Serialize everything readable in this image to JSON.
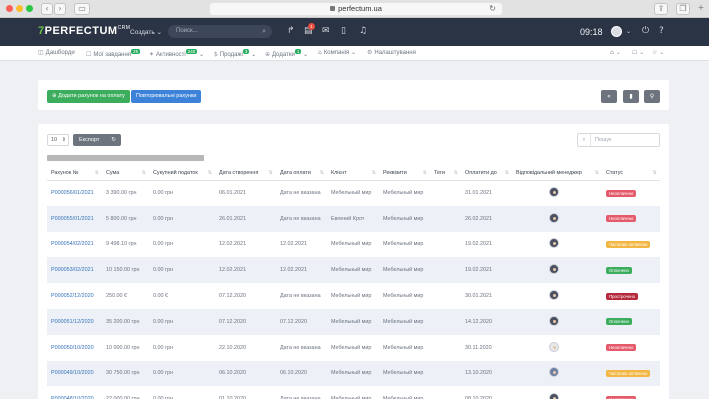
{
  "browser": {
    "url": "perfectum.ua",
    "back_glyph": "‹",
    "forward_glyph": "›",
    "reload_glyph": "↻"
  },
  "topbar": {
    "logo": "PERFECTUM",
    "logo_digit": "7",
    "logo_sup": "CRM",
    "create_label": "Создать ⌄",
    "search_placeholder": "Поиск...",
    "notif_count": "1",
    "time": "09:18",
    "avatar_caret": "⌄",
    "power_glyph": "⏻",
    "help_glyph": "?"
  },
  "nav": {
    "items": [
      {
        "icon": "dashboard-icon",
        "glyph": "◫",
        "label": "Дашборди"
      },
      {
        "icon": "tasks-icon",
        "glyph": "☐",
        "label": "Мої завдання",
        "badge": "25"
      },
      {
        "icon": "activity-icon",
        "glyph": "✦",
        "label": "Активності",
        "badge": "240",
        "caret": "⌄"
      },
      {
        "icon": "sales-icon",
        "glyph": "$",
        "label": "Продажі",
        "badge": "3",
        "caret": "⌄"
      },
      {
        "icon": "add-icon",
        "glyph": "⊕",
        "label": "Додатки",
        "badge": "1",
        "caret": "⌄"
      },
      {
        "icon": "company-icon",
        "glyph": "⌂",
        "label": "Компанія",
        "caret": "⌄"
      },
      {
        "icon": "settings-icon",
        "glyph": "⚙",
        "label": "Налаштування"
      }
    ],
    "right": [
      "⌂ ⌄",
      "☖ ⌄",
      "☆ ⌄"
    ]
  },
  "toolbar": {
    "add_invoice_label": "⊕ Додати рахунок на оплату",
    "recurring_label": "Повторювальні рахунки",
    "icons": [
      "«",
      "▮",
      "⚲"
    ]
  },
  "table_controls": {
    "page_length": "10",
    "export_label": "Експорт",
    "export_icon": "↻",
    "search_placeholder": "Пошук"
  },
  "colors": {
    "overdue": "#e55a6a",
    "partial": "#f2b744",
    "paid": "#3bad5c",
    "expired": "#b42a3a"
  },
  "columns": [
    "Рахунок №",
    "Сума",
    "Сукупний податок",
    "Дата створення",
    "Дата оплати",
    "Клієнт",
    "Реквізити",
    "Теги",
    "Оплатити до",
    "Відповідальний менеджер",
    "Статус"
  ],
  "rows": [
    {
      "number": "P000056/01/2021",
      "sum": "3 390.00 грн",
      "tax": "0.00 грн",
      "created": "06.01.2021",
      "paid": "Дата не вказана",
      "client": "Мебельный мир",
      "requisites": "Мебельный мир",
      "tags": "",
      "due": "31.01.2021",
      "avatar": "dark",
      "status": "Неоплачено",
      "status_type": "overdue"
    },
    {
      "number": "P000055/01/2021",
      "sum": "5 800.00 грн",
      "tax": "0.00 грн",
      "created": "26.01.2021",
      "paid": "Дата не вказана",
      "client": "Евгений Крот",
      "requisites": "Мебельный мир",
      "tags": "",
      "due": "26.02.2021",
      "avatar": "dark",
      "status": "Неоплачено",
      "status_type": "overdue"
    },
    {
      "number": "P000054/02/2021",
      "sum": "9 498.10 грн",
      "tax": "0.00 грн",
      "created": "12.02.2021",
      "paid": "12.02.2021",
      "client": "Мебельный мир",
      "requisites": "Мебельный мир",
      "tags": "",
      "due": "19.02.2021",
      "avatar": "dark",
      "status": "Частково оплачено",
      "status_type": "partial"
    },
    {
      "number": "P000053/02/2021",
      "sum": "10 150.00 грн",
      "tax": "0.00 грн",
      "created": "12.02.2021",
      "paid": "12.02.2021",
      "client": "Мебельный мир",
      "requisites": "Мебельный мир",
      "tags": "",
      "due": "19.02.2021",
      "avatar": "dark",
      "status": "Оплачено",
      "status_type": "paid"
    },
    {
      "number": "P000052/12/2020",
      "sum": "250.00 €",
      "tax": "0.00 €",
      "created": "07.12.2020",
      "paid": "Дата не вказана",
      "client": "Мебельный мир",
      "requisites": "Мебельный мир",
      "tags": "",
      "due": "30.01.2021",
      "avatar": "dark",
      "status": "Прострочено",
      "status_type": "expired"
    },
    {
      "number": "P000051/12/2020",
      "sum": "35 200.00 грн",
      "tax": "0.00 грн",
      "created": "07.12.2020",
      "paid": "07.12.2020",
      "client": "Мебельный мир",
      "requisites": "Мебельный мир",
      "tags": "",
      "due": "14.12.2020",
      "avatar": "dark",
      "status": "Оплачено",
      "status_type": "paid"
    },
    {
      "number": "P000050/10/2020",
      "sum": "10 000.00 грн",
      "tax": "0.00 грн",
      "created": "22.10.2020",
      "paid": "Дата не вказана",
      "client": "Мебельный мир",
      "requisites": "Мебельный мир",
      "tags": "",
      "due": "30.11.2020",
      "avatar": "light",
      "status": "Неоплачено",
      "status_type": "overdue"
    },
    {
      "number": "P000049/10/2020",
      "sum": "30 750.00 грн",
      "tax": "0.00 грн",
      "created": "06.10.2020",
      "paid": "06.10.2020",
      "client": "Мебельный мир",
      "requisites": "Мебельный мир",
      "tags": "",
      "due": "13.10.2020",
      "avatar": "female",
      "status": "Частково оплачено",
      "status_type": "partial"
    },
    {
      "number": "P000048/10/2020",
      "sum": "22 000.00 грн",
      "tax": "0.00 грн",
      "created": "01.10.2020",
      "paid": "Дата не вказана",
      "client": "Мебельный мир",
      "requisites": "Мебельный мир",
      "tags": "",
      "due": "08.10.2020",
      "avatar": "dark",
      "status": "Неоплачено",
      "status_type": "overdue"
    }
  ]
}
